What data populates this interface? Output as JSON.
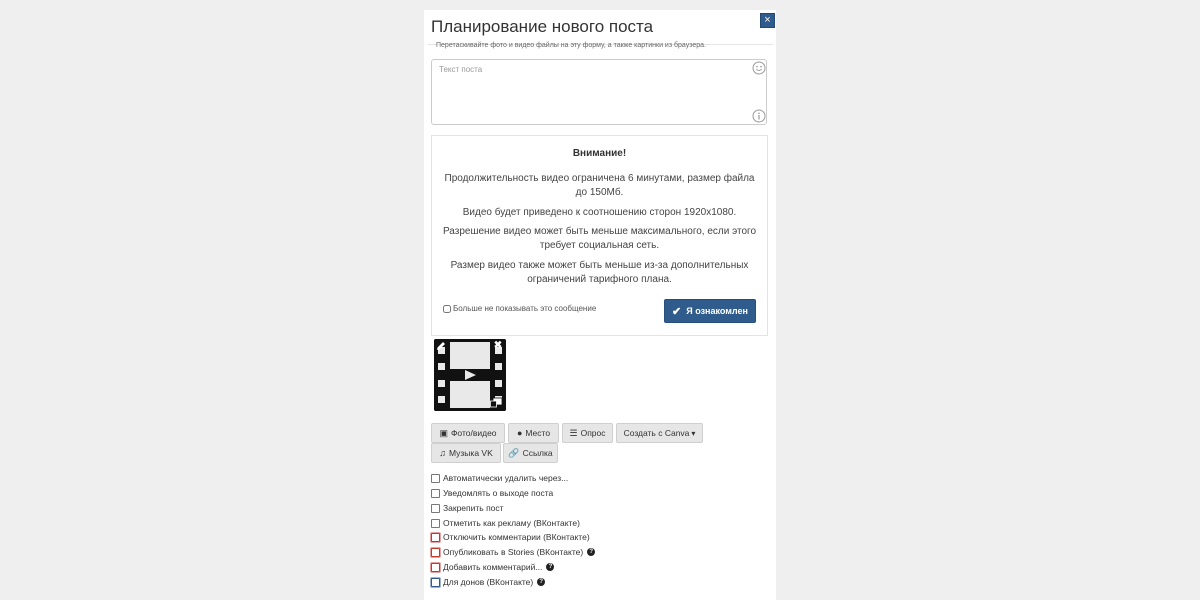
{
  "dialog": {
    "title": "Планирование нового поста",
    "hint": "Перетаскивайте фото и видео файлы на эту форму, а также картинки из браузера.",
    "close_glyph": "×"
  },
  "editor": {
    "placeholder": "Текст поста"
  },
  "notice": {
    "title": "Внимание!",
    "paragraphs": [
      "Продолжительность видео ограничена 6 минутами, размер файла до 150Мб.",
      "Видео будет приведено к соотношению сторон 1920x1080.",
      "Разрешение видео может быть меньше максимального, если этого требует социальная сеть.",
      "Размер видео также может быть меньше из-за дополнительных ограничений тарифного плана."
    ],
    "dont_show_label": "Больше не показывать это сообщение",
    "ack_label": "Я ознакомлен",
    "ack_icon": "✔"
  },
  "media": {
    "remove_glyph": "✖"
  },
  "toolbar": {
    "buttons": [
      {
        "label": "Фото/видео",
        "icon": "image-icon",
        "glyph": "🖼"
      },
      {
        "label": "Место",
        "icon": "map-marker-icon",
        "glyph": "📍"
      },
      {
        "label": "Опрос",
        "icon": "list-icon",
        "glyph": "☰"
      },
      {
        "label": "Создать с Canva",
        "icon": "caret-down-icon",
        "glyph": "▾"
      },
      {
        "label": "Музыка VK",
        "icon": "music-icon",
        "glyph": "♫"
      },
      {
        "label": "Ссылка",
        "icon": "link-icon",
        "glyph": "🔗"
      }
    ]
  },
  "options": [
    {
      "label": "Автоматически удалить через...",
      "style": "normal",
      "help": ""
    },
    {
      "label": "Уведомлять о выходе поста",
      "style": "normal",
      "help": ""
    },
    {
      "label": "Закрепить пост",
      "style": "normal",
      "help": ""
    },
    {
      "label": "Отметить как рекламу (ВКонтакте)",
      "style": "normal",
      "help": ""
    },
    {
      "label": "Отключить комментарии (ВКонтакте)",
      "style": "red",
      "help": ""
    },
    {
      "label": "Опубликовать в Stories (ВКонтакте)",
      "style": "red",
      "help": "?"
    },
    {
      "label": "Добавить комментарий...",
      "style": "red",
      "help": "?"
    },
    {
      "label": "Для донов (ВКонтакте)",
      "style": "blue",
      "help": "?"
    }
  ],
  "colors": {
    "accent": "#2f5b8d",
    "danger_outline": "#c0392b",
    "backdrop": "#efefef"
  }
}
